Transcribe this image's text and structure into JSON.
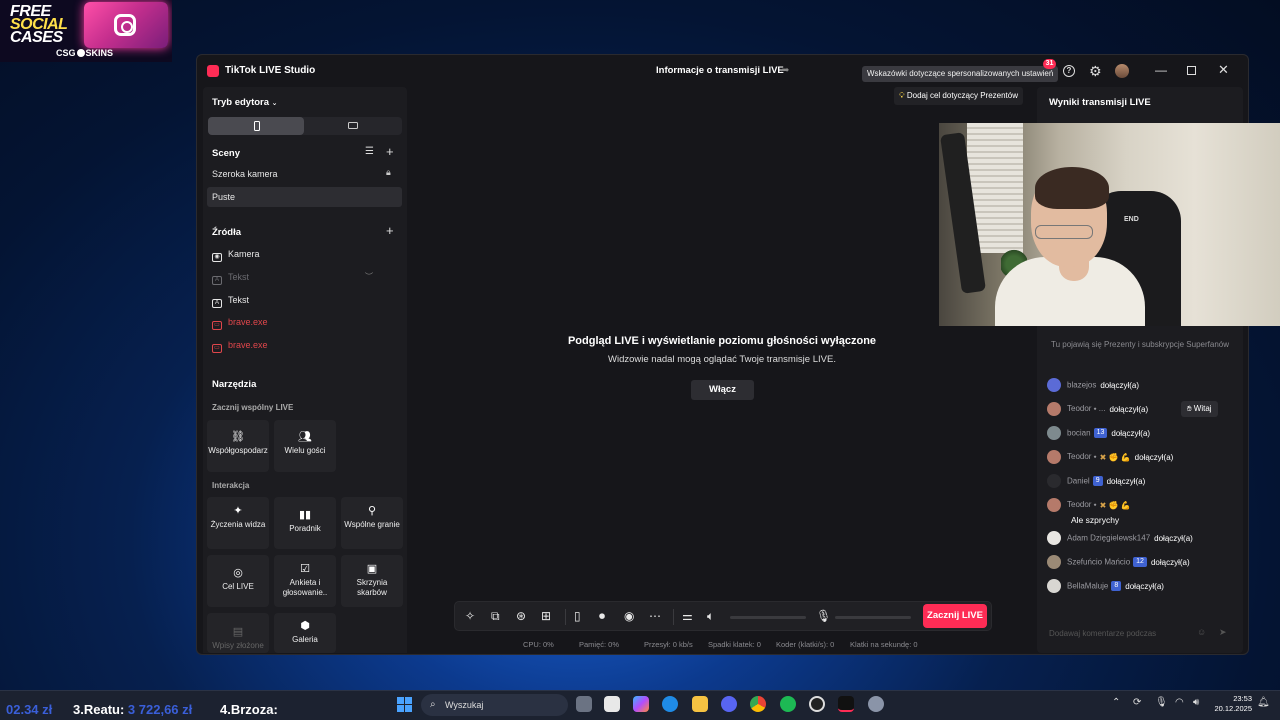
{
  "promo": {
    "line1": "FREE",
    "line2": "SOCIAL",
    "line3": "CASES",
    "brand_left": "CSG",
    "brand_right": "SKINS"
  },
  "window": {
    "app_title": "TikTok LIVE Studio",
    "stream_info": "Informacje o transmisji LIVE",
    "tooltip": "Wskazówki dotyczące spersonalizowanych ustawień",
    "notif_count": "31",
    "help_glyph": "?",
    "gift_goal": "Dodaj cel dotyczący Prezentów"
  },
  "left_panel": {
    "editor_mode": "Tryb edytora",
    "scenes_header": "Sceny",
    "scenes": [
      "Szeroka kamera",
      "Puste"
    ],
    "sources_header": "Źródła",
    "sources": [
      {
        "label": "Kamera",
        "glyph": "◉"
      },
      {
        "label": "Tekst",
        "glyph": "A"
      },
      {
        "label": "Tekst",
        "glyph": "A"
      },
      {
        "label": "brave.exe",
        "glyph": "▭"
      },
      {
        "label": "brave.exe",
        "glyph": "▭"
      }
    ]
  },
  "tools": {
    "header": "Narzędzia",
    "coop_header": "Zacznij wspólny LIVE",
    "coop": [
      "Współgospodarz",
      "Wielu gości"
    ],
    "interaction_header": "Interakcja",
    "interactions": [
      "Życzenia widza",
      "Poradnik",
      "Wspólne granie",
      "Cel LIVE",
      "Ankieta i głosowanie..",
      "Skrzynia skarbów"
    ],
    "more": [
      "Wpisy złożone",
      "Galeria"
    ]
  },
  "preview": {
    "title": "Podgląd LIVE i wyświetlanie poziomu głośności wyłączone",
    "subtitle": "Widzowie nadal mogą oglądać Twoje transmisje LIVE.",
    "enable_button": "Włącz"
  },
  "toolbar": {
    "go_live": "Zacznij LIVE"
  },
  "stats": {
    "cpu": "CPU:  0%",
    "memory": "Pamięć:  0%",
    "bandwidth": "Przesył:  0 kb/s",
    "dropped": "Spadki klatek:  0",
    "encoder": "Koder (klatki/s):  0",
    "fps": "Klatki na sekundę:  0"
  },
  "right_panel": {
    "title": "Wyniki transmisji LIVE",
    "note": "Tu pojawią się Prezenty i subskrypcje Superfanów",
    "witaj": "Witaj",
    "comment_placeholder": "Dodawaj komentarze podczas",
    "chat": [
      {
        "name": "blazejos",
        "level": "",
        "badges": "",
        "event": "dołączył(a)"
      },
      {
        "name": "Teodor ⬩ ...",
        "level": "",
        "badges": "",
        "event": "dołączył(a)"
      },
      {
        "name": "bocian",
        "level": "13",
        "badges": "",
        "event": "dołączył(a)"
      },
      {
        "name": "Teodor ⬩",
        "level": "",
        "badges": "✖ ✊ 💪",
        "event": "dołączył(a)"
      },
      {
        "name": "Daniel",
        "level": "9",
        "badges": "",
        "event": "dołączył(a)"
      },
      {
        "name": "Teodor ⬩",
        "level": "",
        "badges": "✖ ✊ 💪",
        "event": ""
      },
      {
        "name": "Adam Dzięgielewsk147",
        "level": "",
        "badges": "",
        "event": "dołączył(a)"
      },
      {
        "name": "Szefuńcio Mańcio",
        "level": "12",
        "badges": "",
        "event": "dołączył(a)"
      },
      {
        "name": "BellaMaluje",
        "level": "8",
        "badges": "",
        "event": "dołączył(a)"
      }
    ],
    "message": "Ale szprychy"
  },
  "webcam": {
    "chair_label": "END"
  },
  "ticker": {
    "amount1": "02.34 zł",
    "label2": "3.Reatu:",
    "amount2": "3 722,66 zł",
    "label3": "4.Brzoza:"
  },
  "taskbar": {
    "search": "Wyszukaj",
    "time": "23:53",
    "date": "20.12.2025"
  }
}
